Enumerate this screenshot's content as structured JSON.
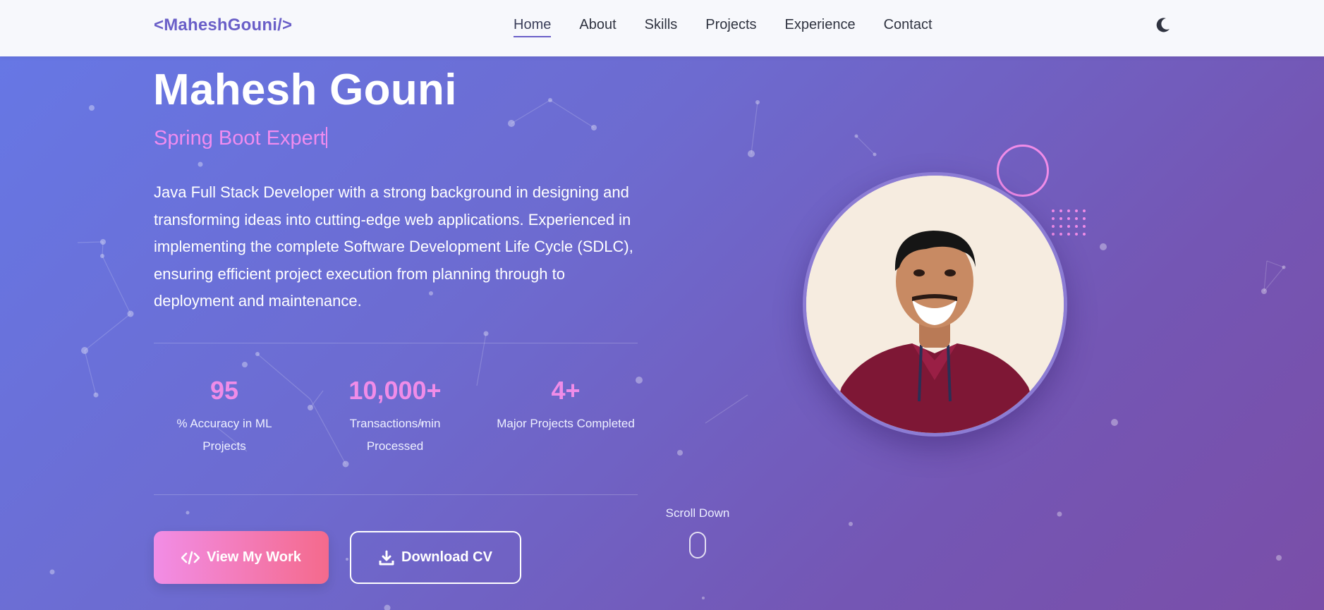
{
  "nav": {
    "logo": "<MaheshGouni/>",
    "links": [
      "Home",
      "About",
      "Skills",
      "Projects",
      "Experience",
      "Contact"
    ],
    "active": "Home",
    "theme_toggle_icon": "moon-icon"
  },
  "hero": {
    "name": "Mahesh Gouni",
    "role": "Spring Boot Expert",
    "bio": "Java Full Stack Developer with a strong background in designing and transforming ideas into cutting-edge web applications. Experienced in implementing the complete Software Development Life Cycle (SDLC), ensuring efficient project execution from planning through to deployment and maintenance.",
    "stats": [
      {
        "value": "95",
        "label": "% Accuracy in ML Projects"
      },
      {
        "value": "10,000+",
        "label": "Transactions/min Processed"
      },
      {
        "value": "4+",
        "label": "Major Projects Completed"
      }
    ],
    "buttons": {
      "primary": {
        "label": "View My Work",
        "icon": "code-icon"
      },
      "secondary": {
        "label": "Download CV",
        "icon": "download-icon"
      }
    },
    "scroll_label": "Scroll Down"
  },
  "colors": {
    "accent": "#f08ce8",
    "logo": "#6a5fc8",
    "gradient_start": "#6678e6",
    "gradient_end": "#7a4ea8"
  }
}
